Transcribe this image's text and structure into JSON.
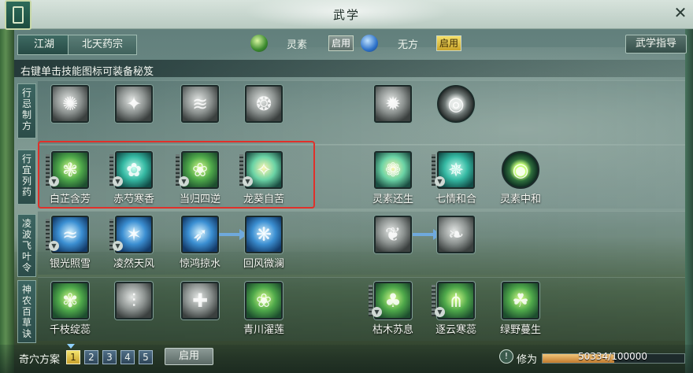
{
  "window": {
    "title": "武学"
  },
  "tabs": [
    {
      "label": "江湖"
    },
    {
      "label": "北天药宗"
    }
  ],
  "toggles": {
    "lingsu": {
      "label": "灵素",
      "button": "启用"
    },
    "wufang": {
      "label": "无方",
      "button": "启用"
    }
  },
  "guide_button": "武学指导",
  "hint": "右键单击技能图标可装备秘笈",
  "rows": [
    {
      "label": "行忌制方",
      "skills": [
        {
          "name": ""
        },
        {
          "name": ""
        },
        {
          "name": ""
        },
        {
          "name": ""
        },
        {
          "name": ""
        },
        {
          "name": ""
        }
      ]
    },
    {
      "label": "行宜列药",
      "skills": [
        {
          "name": "白芷含芳"
        },
        {
          "name": "赤芍寒香"
        },
        {
          "name": "当归四逆"
        },
        {
          "name": "龙葵自苦"
        },
        {
          "name": "灵素还生"
        },
        {
          "name": "七情和合"
        },
        {
          "name": "灵素中和"
        }
      ]
    },
    {
      "label": "凌波飞叶令",
      "skills": [
        {
          "name": "银光照雪"
        },
        {
          "name": "凌然天风"
        },
        {
          "name": "惊鸿掠水"
        },
        {
          "name": "回风微澜"
        },
        {
          "name": ""
        },
        {
          "name": ""
        }
      ]
    },
    {
      "label": "神农百草诀",
      "skills": [
        {
          "name": "千枝绽蕊"
        },
        {
          "name": ""
        },
        {
          "name": ""
        },
        {
          "name": "青川濯莲"
        },
        {
          "name": "枯木苏息"
        },
        {
          "name": "逐云寒蕊"
        },
        {
          "name": "绿野蔓生"
        }
      ]
    }
  ],
  "bottom": {
    "plan_label": "奇穴方案",
    "plans": [
      "1",
      "2",
      "3",
      "4",
      "5"
    ],
    "active_plan": "1",
    "apply_button": "启用",
    "xiuwei_label": "修为",
    "xiuwei_text": "50334/100000",
    "xiuwei_fraction": 0.50334
  },
  "icons": {
    "close": "close-icon",
    "book": "book-icon",
    "info": "info-icon",
    "dropdown": "chevron-down-icon"
  },
  "colors": {
    "highlight_frame": "#e0302a",
    "active_button": "#f3e36c",
    "progress_fill": "#e4a453"
  }
}
